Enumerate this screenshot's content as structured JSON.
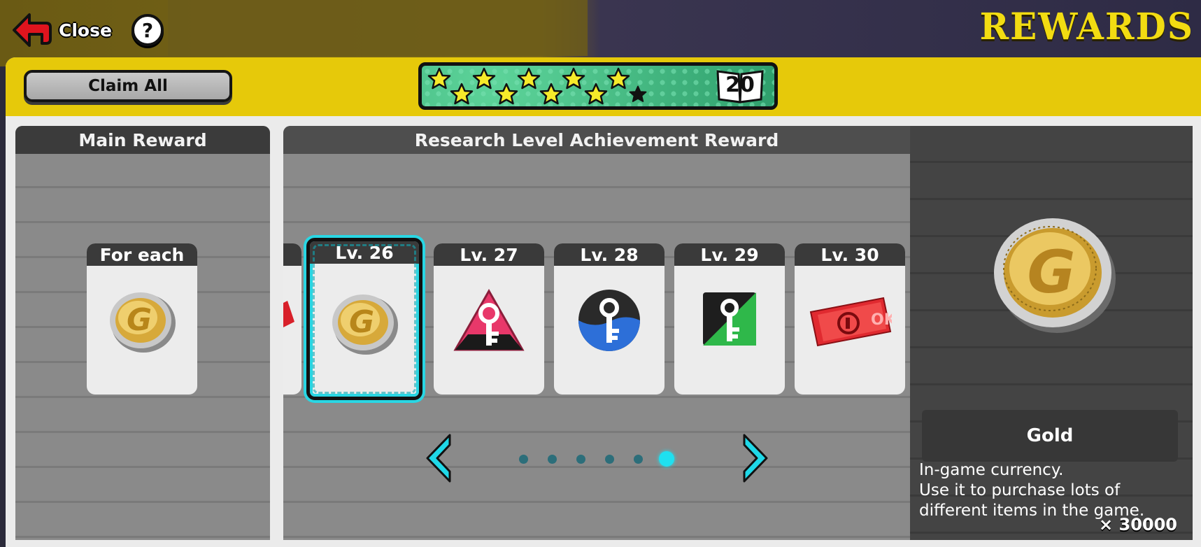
{
  "topbar": {
    "close_label": "Close",
    "help_label": "?",
    "screen_title": "REWARDS"
  },
  "header": {
    "claim_all_label": "Claim All",
    "stars_filled": 9,
    "stars_total": 10,
    "research_level": "20"
  },
  "main_reward": {
    "title": "Main Reward",
    "card_label": "For each",
    "card_icon": "gold-coin-icon"
  },
  "achievement": {
    "title": "Research Level Achievement Reward",
    "cards": [
      {
        "label": "Lv. 26",
        "icon": "gold-coin-icon",
        "selected": true
      },
      {
        "label": "Lv. 27",
        "icon": "pink-triangle-key-icon",
        "selected": false
      },
      {
        "label": "Lv. 28",
        "icon": "blue-circle-key-icon",
        "selected": false
      },
      {
        "label": "Lv. 29",
        "icon": "green-square-key-icon",
        "selected": false
      },
      {
        "label": "Lv. 30",
        "icon": "red-ticket-icon",
        "selected": false
      }
    ],
    "page_count": 6,
    "current_page": 6
  },
  "detail": {
    "quantity": "× 30000",
    "item_name": "Gold",
    "desc_line1": "In-game currency.",
    "desc_line2": "Use it to purchase lots of",
    "desc_line3": "different items in the game."
  },
  "colors": {
    "accent_yellow": "#e6c90a",
    "title_yellow": "#f2dc12",
    "selection_cyan": "#29d6e3",
    "star_bg_green": "#3fb57e"
  }
}
